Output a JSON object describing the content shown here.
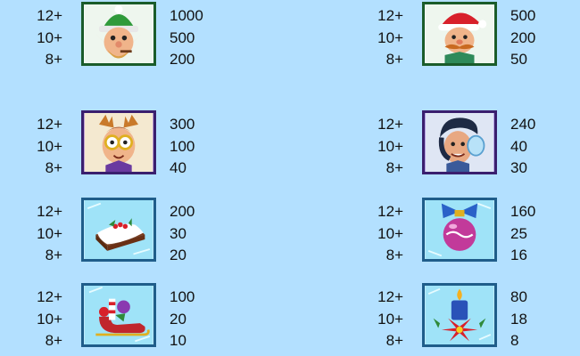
{
  "paytable": {
    "left": [
      {
        "icon": "elf-icon",
        "frame": "candy",
        "counts": [
          "12+",
          "10+",
          "8+"
        ],
        "payouts": [
          "1000",
          "500",
          "200"
        ]
      },
      {
        "icon": "reindeer-kid-icon",
        "frame": "purple",
        "counts": [
          "12+",
          "10+",
          "8+"
        ],
        "payouts": [
          "300",
          "100",
          "40"
        ]
      },
      {
        "icon": "christmas-cake-icon",
        "frame": "ice",
        "counts": [
          "12+",
          "10+",
          "8+"
        ],
        "payouts": [
          "200",
          "30",
          "20"
        ]
      },
      {
        "icon": "sleigh-icon",
        "frame": "ice",
        "counts": [
          "12+",
          "10+",
          "8+"
        ],
        "payouts": [
          "100",
          "20",
          "10"
        ]
      }
    ],
    "right": [
      {
        "icon": "santa-icon",
        "frame": "candy",
        "counts": [
          "12+",
          "10+",
          "8+"
        ],
        "payouts": [
          "500",
          "200",
          "50"
        ]
      },
      {
        "icon": "earmuffs-kid-icon",
        "frame": "purple",
        "counts": [
          "12+",
          "10+",
          "8+"
        ],
        "payouts": [
          "240",
          "40",
          "30"
        ]
      },
      {
        "icon": "ornament-bauble-icon",
        "frame": "ice",
        "counts": [
          "12+",
          "10+",
          "8+"
        ],
        "payouts": [
          "160",
          "25",
          "16"
        ]
      },
      {
        "icon": "candle-poinsettia-icon",
        "frame": "ice",
        "counts": [
          "12+",
          "10+",
          "8+"
        ],
        "payouts": [
          "80",
          "18",
          "8"
        ]
      }
    ]
  },
  "colors": {
    "background": "#b3e0ff",
    "text": "#111111",
    "candy_frame": "#c0262d",
    "purple_frame": "#8d5cd6",
    "ice_frame": "#d9f3ff"
  }
}
